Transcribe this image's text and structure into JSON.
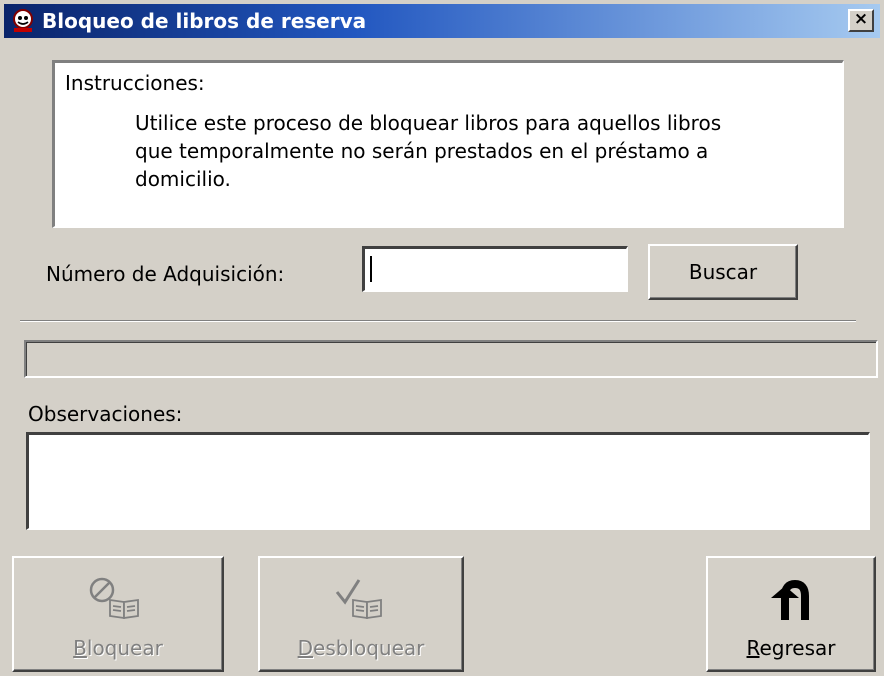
{
  "window": {
    "title": "Bloqueo de libros de reserva",
    "close_glyph": "×"
  },
  "instructions": {
    "label": "Instrucciones:",
    "body": "Utilice este proceso de bloquear libros para aquellos libros que temporalmente no serán prestados en el préstamo a domicilio."
  },
  "search": {
    "label": "Número de Adquisición:",
    "value": "",
    "button_label": "Buscar"
  },
  "status": {
    "text": ""
  },
  "observations": {
    "label": "Observaciones:",
    "value": ""
  },
  "actions": {
    "bloquear": {
      "hotkey": "B",
      "rest": "loquear",
      "icon": "block-book-icon",
      "enabled": false
    },
    "desbloquear": {
      "hotkey": "D",
      "rest": "esbloquear",
      "icon": "check-book-icon",
      "enabled": false
    },
    "regresar": {
      "hotkey": "R",
      "rest": "egresar",
      "icon": "u-turn-arrow-icon",
      "enabled": true
    }
  }
}
